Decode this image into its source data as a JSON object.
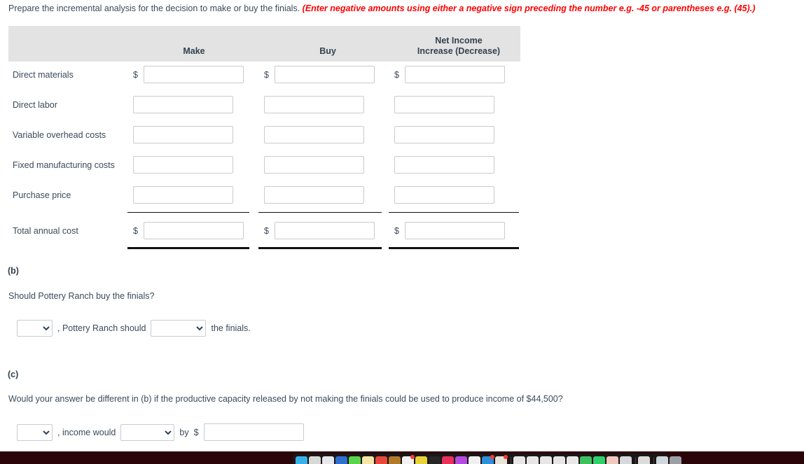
{
  "prompt": {
    "text": "Prepare the incremental analysis for the decision to make or buy the finials.",
    "hint": "(Enter negative amounts using either a negative sign preceding the number e.g. -45 or parentheses e.g. (45).)"
  },
  "table": {
    "headers": {
      "label_col": "",
      "make": "Make",
      "buy": "Buy",
      "net_income_line1": "Net Income",
      "net_income_line2": "Increase (Decrease)"
    },
    "currency_symbol": "$",
    "rows": [
      {
        "label": "Direct materials",
        "show_dollar": true,
        "make": "",
        "buy": "",
        "net": ""
      },
      {
        "label": "Direct labor",
        "show_dollar": false,
        "make": "",
        "buy": "",
        "net": ""
      },
      {
        "label": "Variable overhead costs",
        "show_dollar": false,
        "make": "",
        "buy": "",
        "net": ""
      },
      {
        "label": "Fixed manufacturing costs",
        "show_dollar": false,
        "make": "",
        "buy": "",
        "net": ""
      },
      {
        "label": "Purchase price",
        "show_dollar": false,
        "make": "",
        "buy": "",
        "net": ""
      }
    ],
    "total_row": {
      "label": "Total annual cost",
      "show_dollar": true,
      "make": "",
      "buy": "",
      "net": ""
    }
  },
  "part_b": {
    "letter": "(b)",
    "question": "Should Pottery Ranch buy the finials?",
    "dropdown1_value": "",
    "text_middle": ", Pottery Ranch should",
    "dropdown2_value": "",
    "text_end": "the finials."
  },
  "part_c": {
    "letter": "(c)",
    "question": "Would your answer be different in (b) if the productive capacity released by not making the finials could be used to produce income of $44,500?",
    "dropdown1_value": "",
    "text_middle": ", income would",
    "dropdown2_value": "",
    "text_by": "by",
    "currency_symbol": "$",
    "amount_value": ""
  },
  "dock": {
    "icons": [
      {
        "name": "finder-icon",
        "color": "#3ab0e8",
        "badge": false
      },
      {
        "name": "launchpad-icon",
        "color": "#d8d8d8",
        "badge": false
      },
      {
        "name": "safari-icon",
        "color": "#e8e8ec",
        "badge": false
      },
      {
        "name": "mail-icon",
        "color": "#2f6fd0",
        "badge": false
      },
      {
        "name": "messages-icon",
        "color": "#5ad44a",
        "badge": false
      },
      {
        "name": "notes-icon",
        "color": "#f5e6a8",
        "badge": false
      },
      {
        "name": "maps-icon",
        "color": "#e8473c",
        "badge": false
      },
      {
        "name": "contacts-icon",
        "color": "#b07a2a",
        "badge": false
      },
      {
        "name": "calendar-icon",
        "color": "#f2f2f2",
        "badge": true
      },
      {
        "name": "reminders-icon",
        "color": "#e8d23a",
        "badge": false
      },
      {
        "name": "terminal-icon",
        "color": "#262626",
        "badge": false
      },
      {
        "name": "music-icon",
        "color": "#e8305a",
        "badge": false
      },
      {
        "name": "podcasts-icon",
        "color": "#b44ae0",
        "badge": false
      },
      {
        "name": "appstore-icon",
        "color": "#f0f0f0",
        "badge": false
      },
      {
        "name": "dropbox-icon",
        "color": "#2f8fd8",
        "badge": true
      },
      {
        "name": "photos-icon",
        "color": "#e8e2d8",
        "badge": true
      },
      {
        "separator": true
      },
      {
        "name": "word-icon",
        "color": "#e6e6e6",
        "badge": false
      },
      {
        "name": "excel-icon",
        "color": "#e6e6e6",
        "badge": false
      },
      {
        "name": "powerpoint-icon",
        "color": "#e6e6e6",
        "badge": false
      },
      {
        "name": "onenote-icon",
        "color": "#e6e6e6",
        "badge": false
      },
      {
        "name": "notes2-icon",
        "color": "#e8e8e8",
        "badge": false
      },
      {
        "name": "chrome-icon",
        "color": "#3fc060",
        "badge": false
      },
      {
        "name": "spotify-icon",
        "color": "#2fd06a",
        "badge": false
      },
      {
        "name": "acrobat-icon",
        "color": "#f0c8c0",
        "badge": false
      },
      {
        "name": "preview-icon",
        "color": "#d8d8dc",
        "badge": false
      },
      {
        "separator": true
      },
      {
        "name": "downloads-icon",
        "color": "#dcdcdc",
        "badge": false
      },
      {
        "separator2": true
      },
      {
        "name": "folder-icon",
        "color": "#cfd6dc",
        "badge": false
      },
      {
        "name": "trash-icon",
        "color": "#9aa0a6",
        "badge": false
      }
    ]
  }
}
